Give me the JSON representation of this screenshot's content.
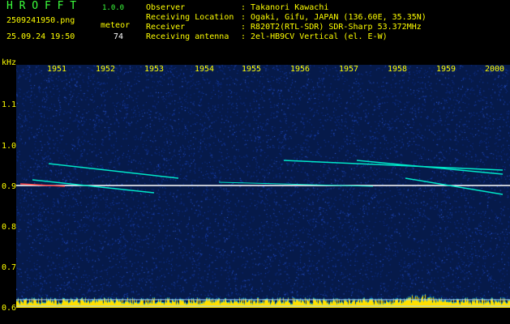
{
  "header": {
    "app_title": "H R O F F T",
    "app_version": "1.0.0",
    "file_name": "2509241950.png",
    "datetime": "25.09.24 19:50",
    "meteor_label": "meteor",
    "meteor_count": "74"
  },
  "info": [
    {
      "label": "Observer",
      "value": ": Takanori Kawachi"
    },
    {
      "label": "Receiving Location",
      "value": ": Ogaki, Gifu, JAPAN (136.60E, 35.35N)"
    },
    {
      "label": "Receiver",
      "value": ": R820T2(RTL-SDR) SDR-Sharp 53.372MHz"
    },
    {
      "label": "Receiving antenna",
      "value": ": 2el-HB9CV Vertical (el. E-W)"
    }
  ],
  "axis": {
    "unit": "kHz",
    "x_ticks": [
      "1951",
      "1952",
      "1953",
      "1954",
      "1955",
      "1956",
      "1957",
      "1958",
      "1959",
      "2000"
    ],
    "y_ticks": [
      "1.1",
      "1.0",
      "0.9",
      "0.8",
      "0.7",
      "0.6"
    ]
  },
  "colors": {
    "background": "#061a4a",
    "text_yellow": "#ffff00",
    "text_green": "#3cff3c",
    "text_white": "#ffffff",
    "carrier": "#ffffff",
    "echo": "#00e6c8",
    "noise_bar": "#ffe000"
  }
}
